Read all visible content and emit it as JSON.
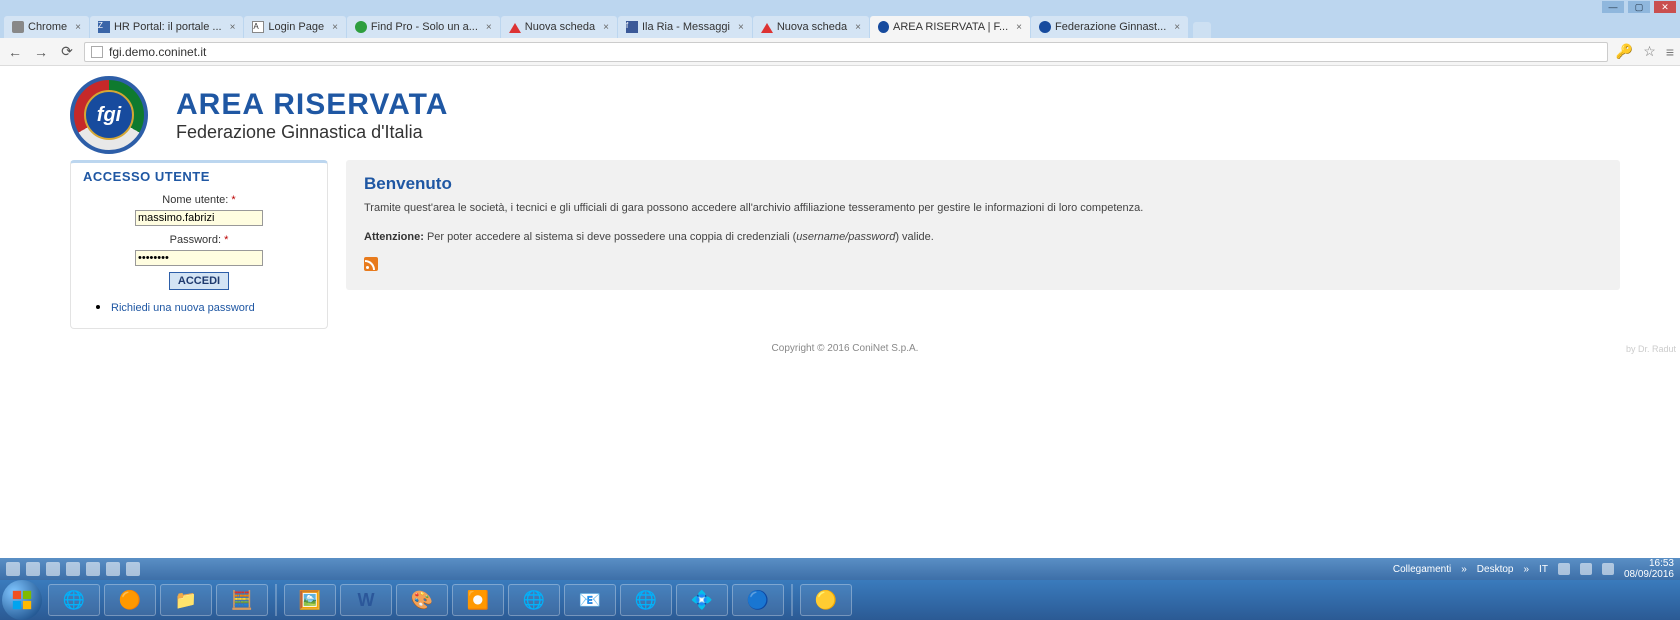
{
  "window": {
    "tabs": [
      {
        "label": "Chrome"
      },
      {
        "label": "HR Portal: il portale ..."
      },
      {
        "label": "Login Page"
      },
      {
        "label": "Find Pro - Solo un a..."
      },
      {
        "label": "Nuova scheda"
      },
      {
        "label": "Ila Ria - Messaggi"
      },
      {
        "label": "Nuova scheda"
      },
      {
        "label": "AREA RISERVATA | F..."
      },
      {
        "label": "Federazione Ginnast..."
      }
    ],
    "url": "fgi.demo.coninet.it"
  },
  "page": {
    "title": "AREA RISERVATA",
    "subtitle": "Federazione Ginnastica d'Italia",
    "login": {
      "box_title": "ACCESSO UTENTE",
      "username_label": "Nome utente:",
      "username_value": "massimo.fabrizi",
      "password_label": "Password:",
      "password_value": "••••••••",
      "submit_label": "ACCEDI",
      "forgot_label": "Richiedi una nuova password"
    },
    "main": {
      "heading": "Benvenuto",
      "intro": "Tramite quest'area le società, i tecnici e gli ufficiali di gara possono accedere all'archivio affiliazione tesseramento per gestire le informazioni di loro competenza.",
      "warning_prefix": "Attenzione:",
      "warning_text_a": " Per poter accedere al sistema si deve possedere una coppia di credenziali (",
      "warning_italic": "username/password",
      "warning_text_b": ") valide."
    },
    "copyright": "Copyright © 2016 ConiNet S.p.A.",
    "watermark": "by Dr. Radut"
  },
  "tray": {
    "links_label": "Collegamenti",
    "desktop_label": "Desktop",
    "lang": "IT",
    "time": "16:53",
    "date": "08/09/2016"
  }
}
